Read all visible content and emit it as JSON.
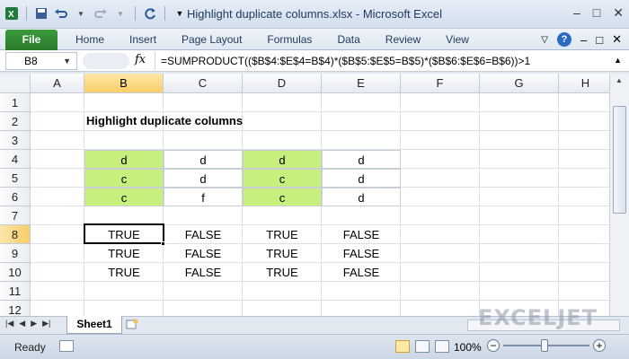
{
  "window": {
    "title": "Highlight duplicate columns.xlsx - Microsoft Excel",
    "controls": [
      "–",
      "□",
      "✕"
    ]
  },
  "qat": {
    "icons": [
      "excel-logo-icon",
      "save-icon",
      "undo-icon",
      "redo-icon",
      "customize-icon"
    ]
  },
  "ribbon": {
    "file_label": "File",
    "tabs": [
      "Home",
      "Insert",
      "Page Layout",
      "Formulas",
      "Data",
      "Review",
      "View"
    ],
    "help_label": "?"
  },
  "formula_bar": {
    "name_box": "B8",
    "fx_label": "fx",
    "formula": "=SUMPRODUCT(($B$4:$E$4=B$4)*($B$5:$E$5=B$5)*($B$6:$E$6=B$6))>1"
  },
  "sheet": {
    "columns": [
      "A",
      "B",
      "C",
      "D",
      "E",
      "F",
      "G",
      "H"
    ],
    "selected_column": "B",
    "rows": [
      "1",
      "2",
      "3",
      "4",
      "5",
      "6",
      "7",
      "8",
      "9",
      "10",
      "11",
      "12"
    ],
    "selected_row": "8",
    "heading": "Highlight duplicate columns",
    "data_table": [
      [
        "d",
        "d",
        "d",
        "d"
      ],
      [
        "c",
        "d",
        "c",
        "d"
      ],
      [
        "c",
        "f",
        "c",
        "d"
      ]
    ],
    "highlight_color": "#c6ef7e",
    "results": [
      [
        "TRUE",
        "FALSE",
        "TRUE",
        "FALSE"
      ],
      [
        "TRUE",
        "FALSE",
        "TRUE",
        "FALSE"
      ],
      [
        "TRUE",
        "FALSE",
        "TRUE",
        "FALSE"
      ]
    ]
  },
  "tabs_bar": {
    "sheet_name": "Sheet1",
    "watermark": "EXCELJET"
  },
  "status_bar": {
    "status": "Ready",
    "zoom": "100%",
    "zoom_minus": "−",
    "zoom_plus": "+"
  }
}
